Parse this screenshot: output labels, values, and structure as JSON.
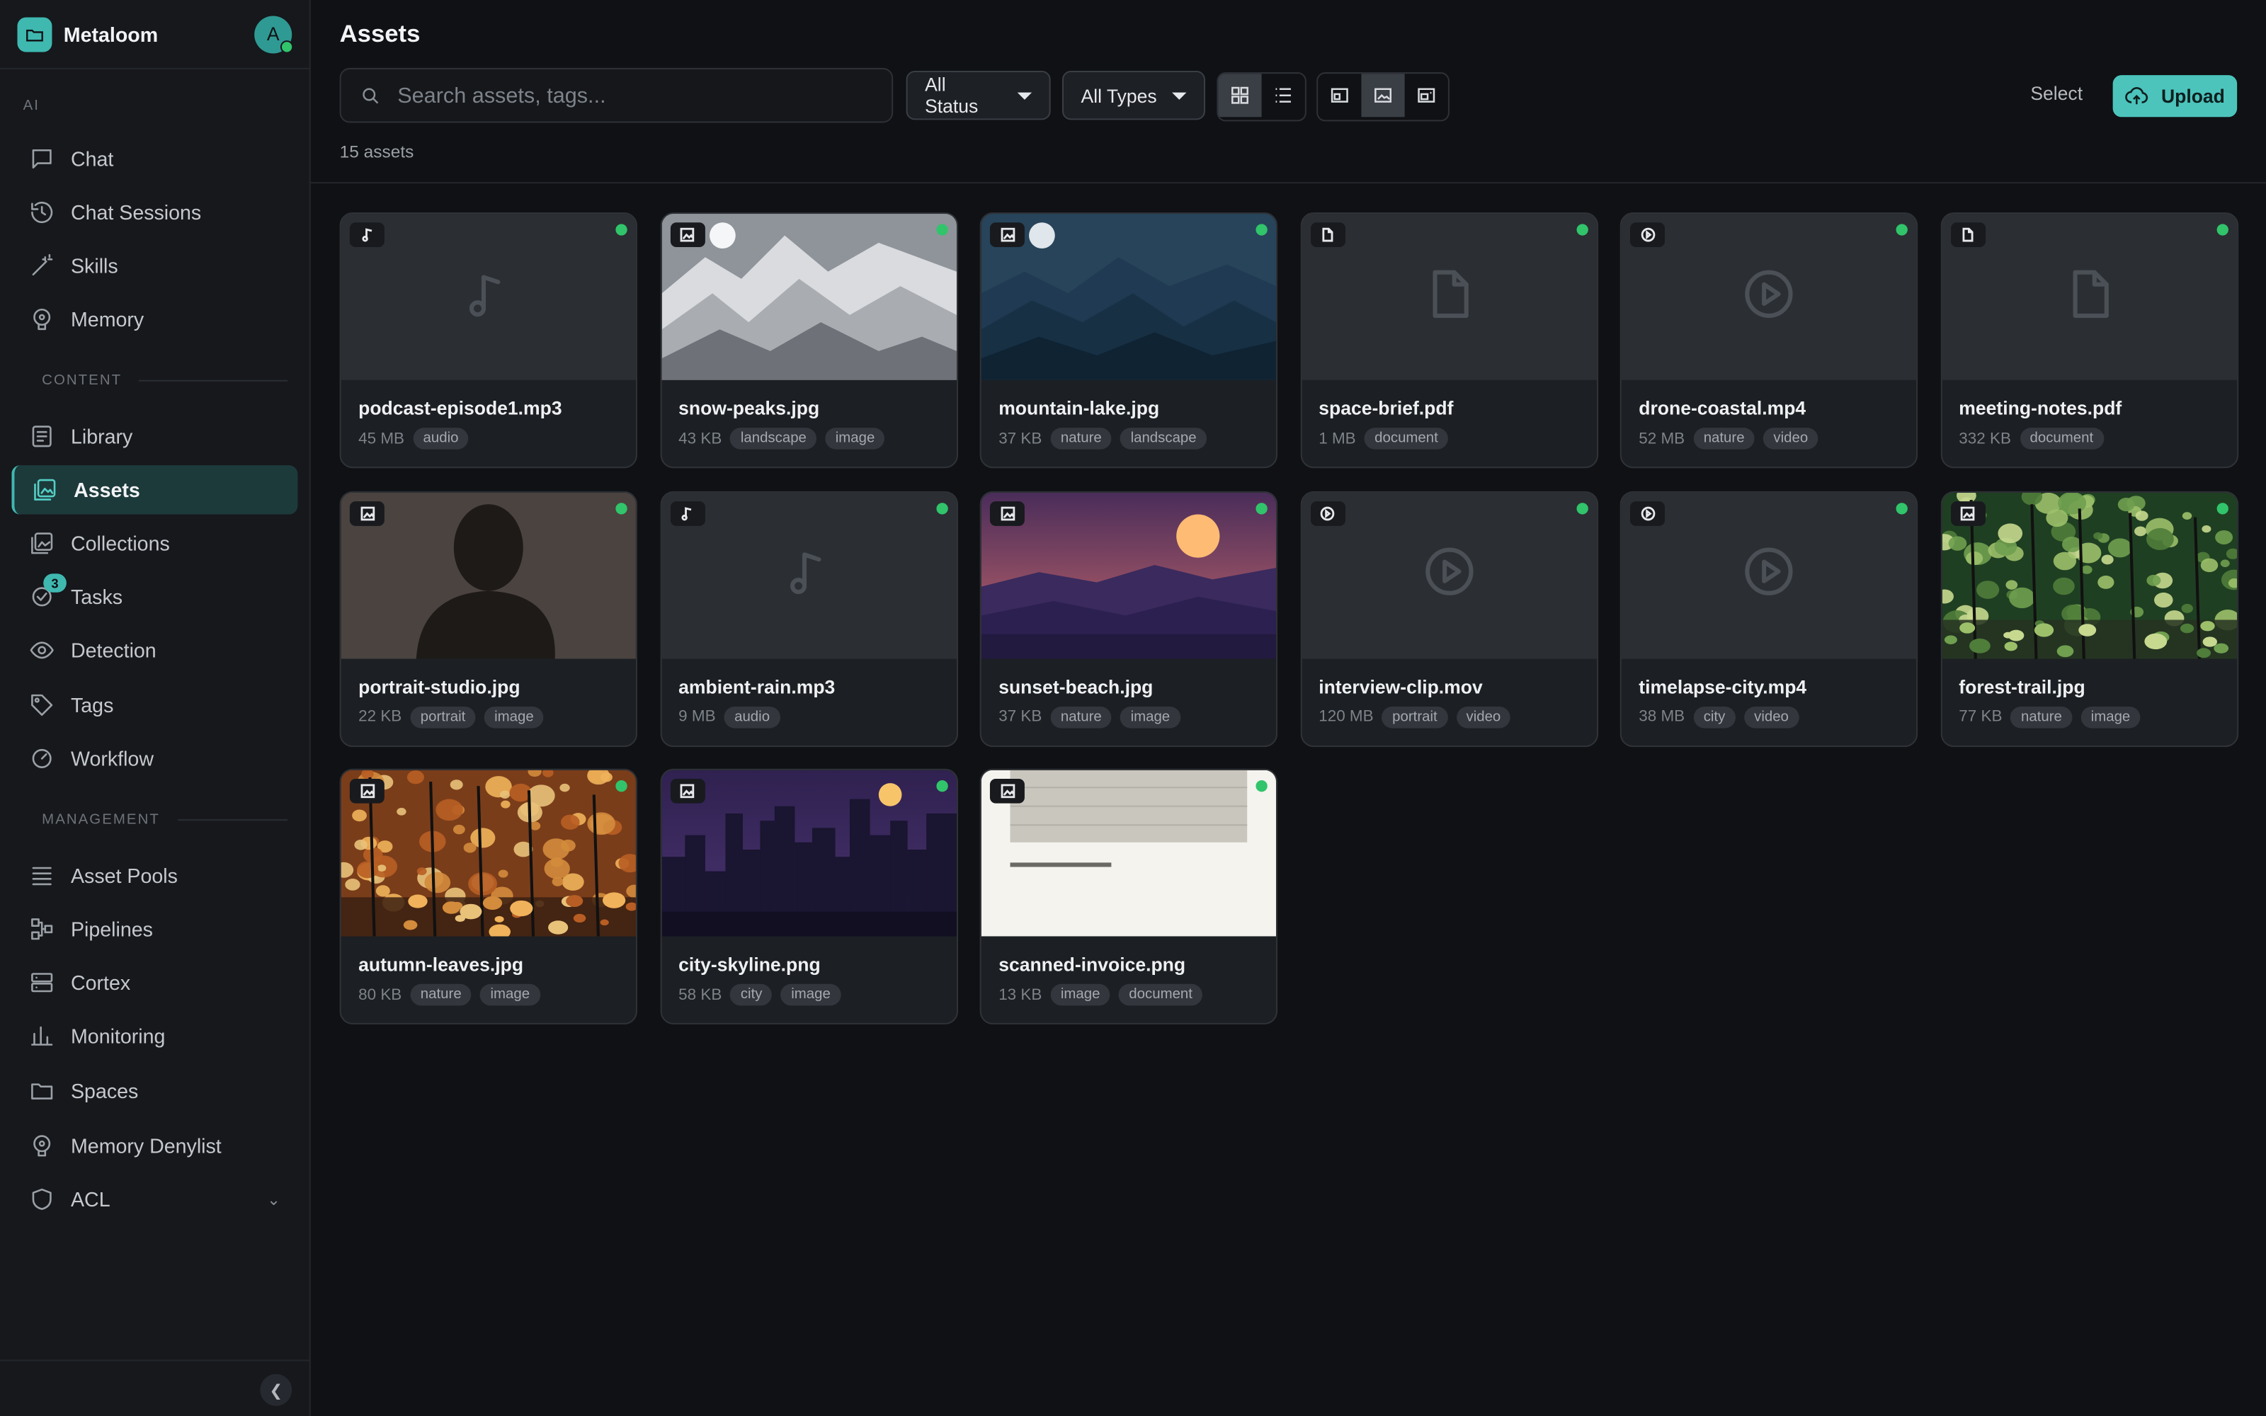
{
  "app": {
    "name": "Metaloom",
    "avatar_initial": "A"
  },
  "sidebar": {
    "sections": {
      "ai": "AI",
      "content": "CONTENT",
      "management": "MANAGEMENT"
    },
    "items": [
      {
        "label": "Chat",
        "icon": "chat-icon"
      },
      {
        "label": "Chat Sessions",
        "icon": "history-icon"
      },
      {
        "label": "Skills",
        "icon": "wand-icon"
      },
      {
        "label": "Memory",
        "icon": "brain-icon"
      },
      {
        "label": "Library",
        "icon": "library-icon"
      },
      {
        "label": "Assets",
        "icon": "image-stack-icon",
        "active": true
      },
      {
        "label": "Collections",
        "icon": "collection-icon"
      },
      {
        "label": "Tasks",
        "icon": "check-circle-icon",
        "badge": "3"
      },
      {
        "label": "Detection",
        "icon": "eye-icon"
      },
      {
        "label": "Tags",
        "icon": "tag-icon"
      },
      {
        "label": "Workflow",
        "icon": "gauge-icon"
      },
      {
        "label": "Asset Pools",
        "icon": "stack-icon"
      },
      {
        "label": "Pipelines",
        "icon": "pipeline-icon"
      },
      {
        "label": "Cortex",
        "icon": "server-icon"
      },
      {
        "label": "Monitoring",
        "icon": "bar-chart-icon"
      },
      {
        "label": "Spaces",
        "icon": "folder-icon"
      },
      {
        "label": "Memory Denylist",
        "icon": "brain-icon"
      },
      {
        "label": "ACL",
        "icon": "shield-icon"
      }
    ]
  },
  "header": {
    "title": "Assets",
    "search_placeholder": "Search assets, tags...",
    "status_filter": "All Status",
    "type_filter": "All Types",
    "view_mode": "grid",
    "thumb_size": "medium",
    "select_label": "Select",
    "upload_label": "Upload",
    "count_text": "15 assets"
  },
  "assets": [
    {
      "name": "podcast-episode1.mp3",
      "size": "45 MB",
      "tags": [
        "audio"
      ],
      "type": "audio",
      "art": "audio"
    },
    {
      "name": "snow-peaks.jpg",
      "size": "43 KB",
      "tags": [
        "landscape",
        "image"
      ],
      "type": "image",
      "art": "snow"
    },
    {
      "name": "mountain-lake.jpg",
      "size": "37 KB",
      "tags": [
        "nature",
        "landscape"
      ],
      "type": "image",
      "art": "lake"
    },
    {
      "name": "space-brief.pdf",
      "size": "1 MB",
      "tags": [
        "document"
      ],
      "type": "document",
      "art": "doc"
    },
    {
      "name": "drone-coastal.mp4",
      "size": "52 MB",
      "tags": [
        "nature",
        "video"
      ],
      "type": "video",
      "art": "video"
    },
    {
      "name": "meeting-notes.pdf",
      "size": "332 KB",
      "tags": [
        "document"
      ],
      "type": "document",
      "art": "doc"
    },
    {
      "name": "portrait-studio.jpg",
      "size": "22 KB",
      "tags": [
        "portrait",
        "image"
      ],
      "type": "image",
      "art": "portrait"
    },
    {
      "name": "ambient-rain.mp3",
      "size": "9 MB",
      "tags": [
        "audio"
      ],
      "type": "audio",
      "art": "audio"
    },
    {
      "name": "sunset-beach.jpg",
      "size": "37 KB",
      "tags": [
        "nature",
        "image"
      ],
      "type": "image",
      "art": "sunset"
    },
    {
      "name": "interview-clip.mov",
      "size": "120 MB",
      "tags": [
        "portrait",
        "video"
      ],
      "type": "video",
      "art": "video"
    },
    {
      "name": "timelapse-city.mp4",
      "size": "38 MB",
      "tags": [
        "city",
        "video"
      ],
      "type": "video",
      "art": "video"
    },
    {
      "name": "forest-trail.jpg",
      "size": "77 KB",
      "tags": [
        "nature",
        "image"
      ],
      "type": "image",
      "art": "forest"
    },
    {
      "name": "autumn-leaves.jpg",
      "size": "80 KB",
      "tags": [
        "nature",
        "image"
      ],
      "type": "image",
      "art": "autumn"
    },
    {
      "name": "city-skyline.png",
      "size": "58 KB",
      "tags": [
        "city",
        "image"
      ],
      "type": "image",
      "art": "city"
    },
    {
      "name": "scanned-invoice.png",
      "size": "13 KB",
      "tags": [
        "image",
        "document"
      ],
      "type": "image",
      "art": "invoice"
    }
  ],
  "colors": {
    "accent": "#4cc4bc",
    "status_ready": "#31c46b",
    "active_bg": "#1d3a3b"
  }
}
